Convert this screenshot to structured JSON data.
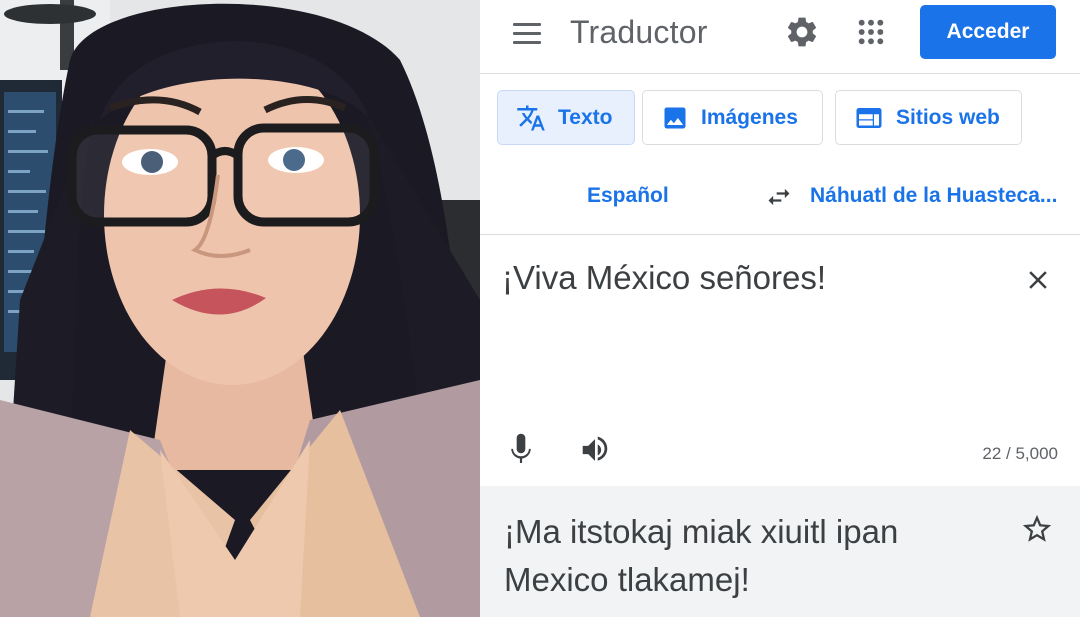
{
  "photo": {
    "alt": "selfie"
  },
  "header": {
    "title": "Traductor",
    "signin_label": "Acceder",
    "icons": [
      "menu-icon",
      "gear-icon",
      "apps-icon"
    ]
  },
  "tabs": [
    {
      "label": "Texto",
      "icon": "translate-icon",
      "active": true
    },
    {
      "label": "Imágenes",
      "icon": "image-icon",
      "active": false
    },
    {
      "label": "Sitios web",
      "icon": "web-icon",
      "active": false
    }
  ],
  "languages": {
    "source": "Español",
    "target": "Náhuatl de la Huasteca...",
    "swap_icon": "swap-icon"
  },
  "input": {
    "text": "¡Viva México señores!",
    "char_count": "22 / 5,000"
  },
  "output": {
    "text": "¡Ma itstokaj miak xiuitl ipan Mexico tlakamej!"
  },
  "colors": {
    "accent": "#1a73e8",
    "text": "#3c4043",
    "muted": "#5f6368",
    "active_tab_bg": "#e8f0fe",
    "output_bg": "#f1f3f4"
  }
}
